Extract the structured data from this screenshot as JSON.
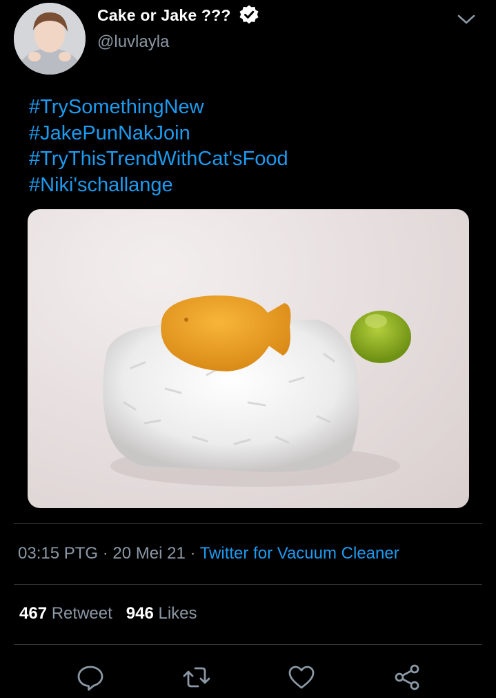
{
  "tweet": {
    "display_name": "Cake or Jake ???",
    "handle": "@luvlayla",
    "hashtags": [
      "#TrySomethingNew",
      "#JakePunNakJoin",
      "#TryThisTrendWithCat'sFood",
      "#Niki'schallange"
    ]
  },
  "meta": {
    "time": "03:15 PTG",
    "separator": " · ",
    "date": "20 Mei 21",
    "source": "Twitter for Vacuum Cleaner"
  },
  "stats": {
    "retweets_count": "467",
    "retweets_label": "Retweet",
    "likes_count": "946",
    "likes_label": "Likes"
  },
  "colors": {
    "background": "#000000",
    "accent_link": "#1d9bf0",
    "secondary_text": "#8b98a5",
    "divider": "#2f3336"
  },
  "icons": {
    "verified": "verified-badge-icon",
    "more": "chevron-down-icon",
    "reply": "reply-icon",
    "retweet": "retweet-icon",
    "like": "heart-icon",
    "share": "share-icon"
  }
}
